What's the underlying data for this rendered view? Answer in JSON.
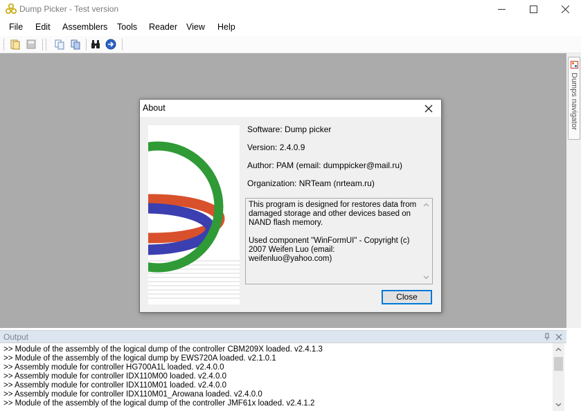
{
  "window": {
    "title": "Dump Picker - Test version"
  },
  "menu": [
    "File",
    "Edit",
    "Assemblers",
    "Tools",
    "Reader",
    "View",
    "Help"
  ],
  "toolbar": {
    "icons": [
      "new-dump-icon",
      "save-dump-icon",
      "copy-icon",
      "paste-icon",
      "find-icon",
      "go-icon"
    ]
  },
  "navigator": {
    "label": "Dumps navigator"
  },
  "about_dialog": {
    "title": "About",
    "software": "Software: Dump picker",
    "version": "Version: 2.4.0.9",
    "author": "Author: PAM (email: dumppicker@mail.ru)",
    "organization": "Organization: NRTeam (nrteam.ru)",
    "description": "This program is designed for restores data from damaged storage and other devices based on NAND flash memory.\n\nUsed component \"WinFormUI\" - Copyright (c) 2007 Weifen Luo (email: weifenluo@yahoo.com)",
    "close_label": "Close"
  },
  "output": {
    "title": "Output",
    "lines": [
      ">>  Module of the assembly of the logical dump of the controller CBM209X loaded. v2.4.1.3",
      ">>  Module of the assembly of the logical dump by EWS720A loaded. v2.1.0.1",
      ">>  Assembly module for controller HG700A1L loaded. v2.4.0.0",
      ">>  Assembly module for controller IDX110M00 loaded. v2.4.0.0",
      ">>  Assembly module for controller IDX110M01 loaded. v2.4.0.0",
      ">>  Assembly module for controller IDX110M01_Arowana loaded. v2.4.0.0",
      ">>  Module of the assembly of the logical dump of the controller JMF61x loaded. v2.4.1.2"
    ]
  },
  "colors": {
    "workspace": "#ababab",
    "dialog_bg": "#f0f0f0",
    "accent_border": "#0078d7",
    "output_header": "#dde6f0",
    "logo_green": "#2f9a36",
    "logo_red": "#d8512c",
    "logo_blue": "#3b3fb0"
  }
}
